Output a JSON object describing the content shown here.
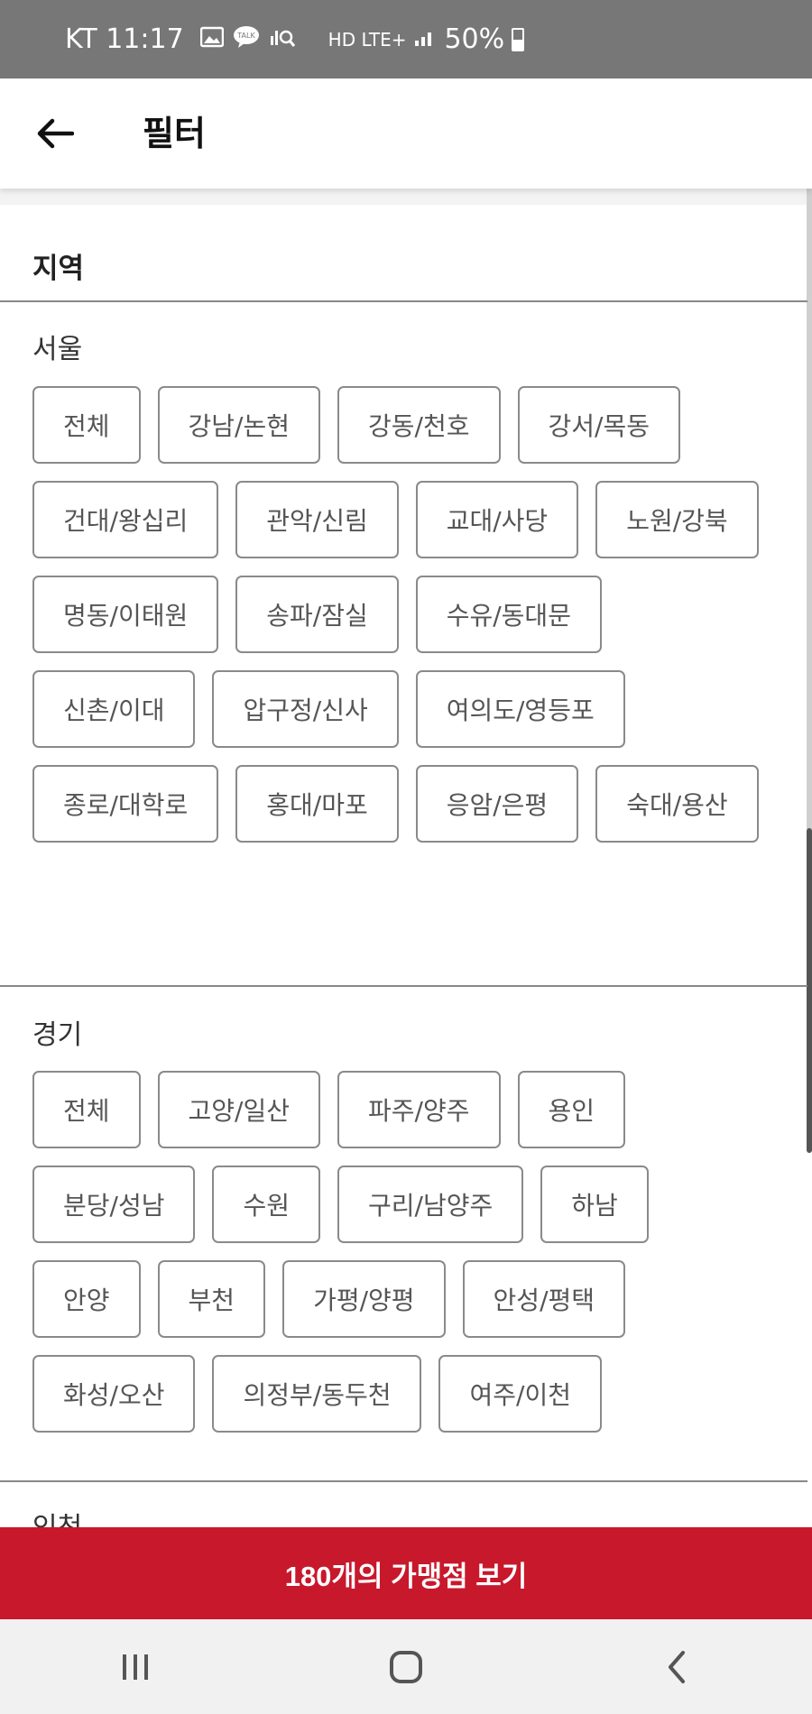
{
  "status_bar": {
    "carrier_time": "KT 11:17",
    "network": "HD LTE+",
    "battery": "50%"
  },
  "header": {
    "title": "필터"
  },
  "filter": {
    "section_title": "지역",
    "groups": [
      {
        "label": "서울",
        "chips": [
          "전체",
          "강남/논현",
          "강동/천호",
          "강서/목동",
          "건대/왕십리",
          "관악/신림",
          "교대/사당",
          "노원/강북",
          "명동/이태원",
          "송파/잠실",
          "수유/동대문",
          "신촌/이대",
          "압구정/신사",
          "여의도/영등포",
          "종로/대학로",
          "홍대/마포",
          "응암/은평",
          "숙대/용산"
        ]
      },
      {
        "label": "경기",
        "chips": [
          "전체",
          "고양/일산",
          "파주/양주",
          "용인",
          "분당/성남",
          "수원",
          "구리/남양주",
          "하남",
          "안양",
          "부천",
          "가평/양평",
          "안성/평택",
          "화성/오산",
          "의정부/동두천",
          "여주/이천"
        ]
      },
      {
        "label": "인천",
        "chips": []
      }
    ]
  },
  "cta": {
    "label": "180개의 가맹점 보기"
  },
  "icons": {
    "back": "arrow-left-icon",
    "recents": "recents-icon",
    "home": "home-icon",
    "nav_back": "chevron-left-icon"
  }
}
